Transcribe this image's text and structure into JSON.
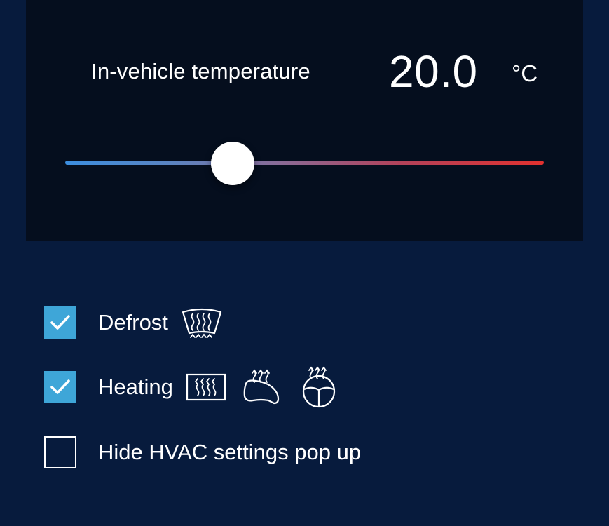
{
  "temperature": {
    "label": "In-vehicle temperature",
    "value": "20.0",
    "unit": "°C",
    "slider_position": 0.35
  },
  "colors": {
    "background": "#071b3d",
    "panel": "#050e1e",
    "checkbox_accent": "#3ea6d8",
    "slider_cold": "#3c8ee0",
    "slider_hot": "#e2312f"
  },
  "options": [
    {
      "label": "Defrost",
      "checked": true,
      "icons": [
        "front-defrost-icon"
      ]
    },
    {
      "label": "Heating",
      "checked": true,
      "icons": [
        "rear-defrost-icon",
        "heated-seat-icon",
        "heated-steering-wheel-icon"
      ]
    },
    {
      "label": "Hide HVAC settings pop up",
      "checked": false,
      "icons": []
    }
  ]
}
